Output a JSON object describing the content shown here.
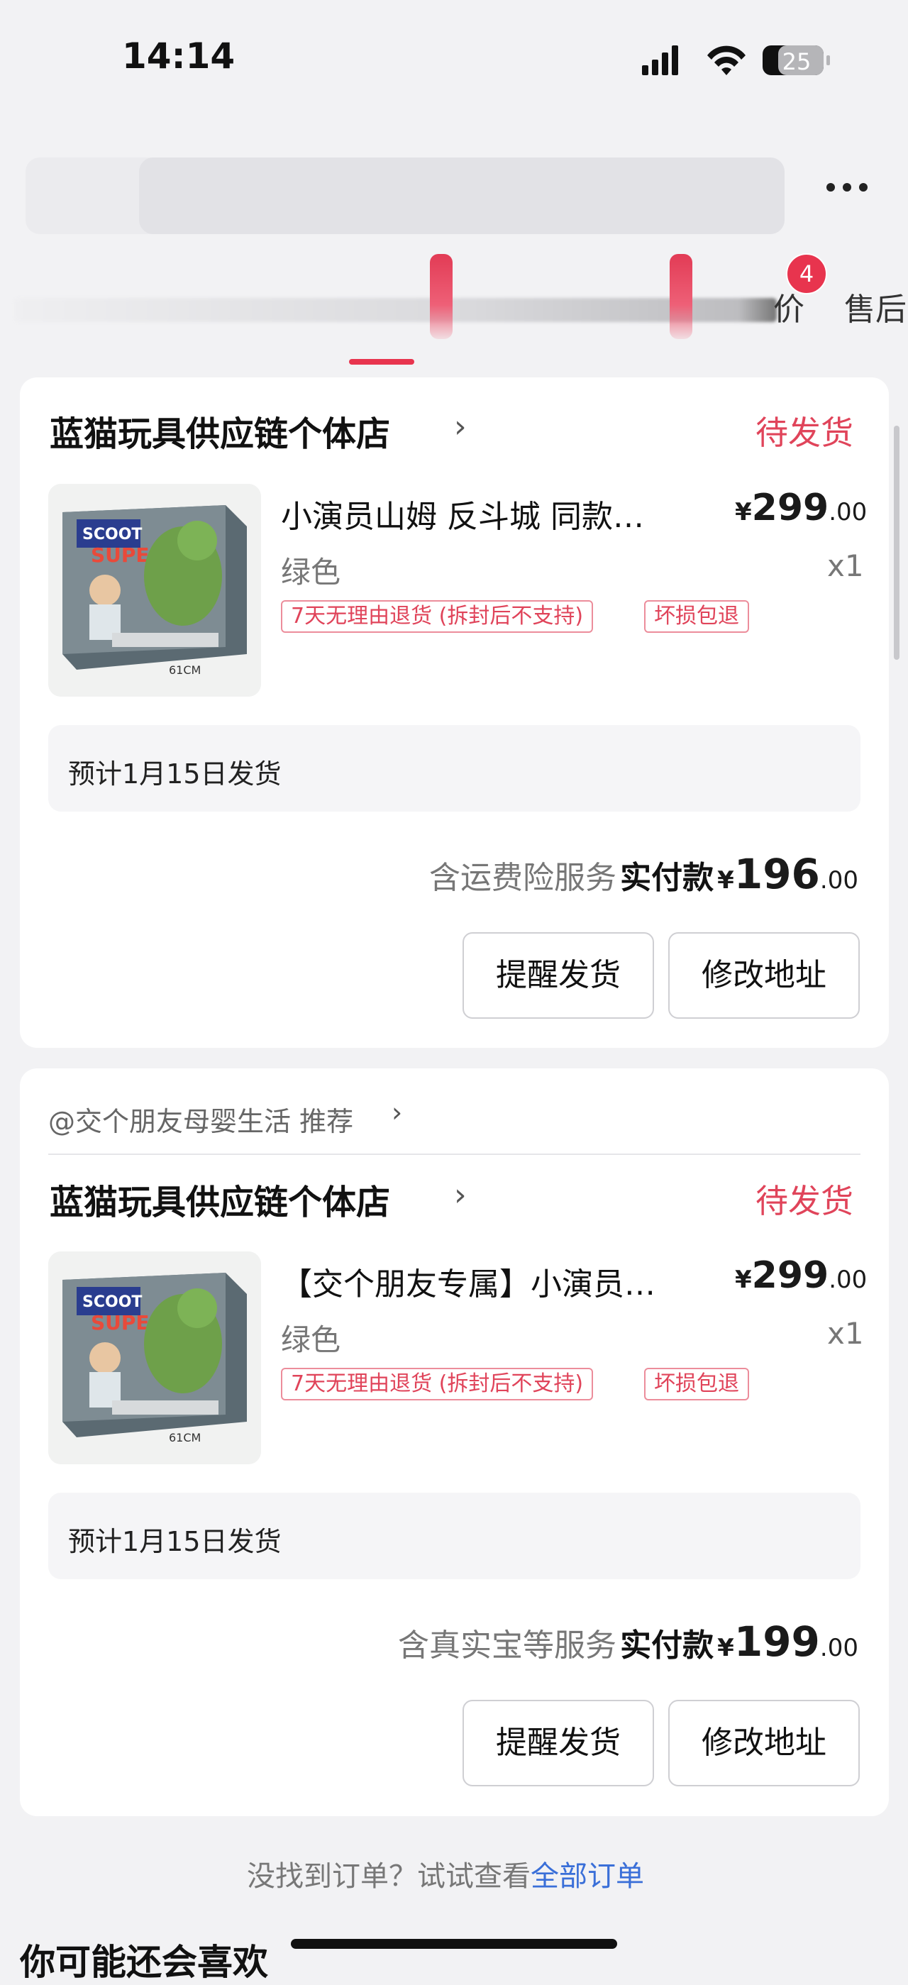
{
  "status_bar": {
    "time": "14:14",
    "battery": "25"
  },
  "tabs": {
    "partial_label": "价",
    "after_sales_label": "售后",
    "badge_count": "4"
  },
  "orders": [
    {
      "recommender": "",
      "store": "蓝猫玩具供应链个体店",
      "status": "待发货",
      "title": "小演员山姆 反斗城 同款…",
      "price_symbol": "¥",
      "price_int": "299",
      "price_dec": ".00",
      "spec": "绿色",
      "qty": "x1",
      "tags": [
        "7天无理由退货 (拆封后不支持)",
        "坏损包退"
      ],
      "shipping": "预计1月15日发货",
      "service": "含运费险服务",
      "pay_label": "实付款",
      "pay_symbol": "¥",
      "pay_int": "196",
      "pay_dec": ".00",
      "btn_remind": "提醒发货",
      "btn_address": "修改地址",
      "thumb_size_label": "61CM"
    },
    {
      "recommender": "@交个朋友母婴生活 推荐",
      "store": "蓝猫玩具供应链个体店",
      "status": "待发货",
      "title": "【交个朋友专属】小演员…",
      "price_symbol": "¥",
      "price_int": "299",
      "price_dec": ".00",
      "spec": "绿色",
      "qty": "x1",
      "tags": [
        "7天无理由退货 (拆封后不支持)",
        "坏损包退"
      ],
      "shipping": "预计1月15日发货",
      "service": "含真实宝等服务",
      "pay_label": "实付款",
      "pay_symbol": "¥",
      "pay_int": "199",
      "pay_dec": ".00",
      "btn_remind": "提醒发货",
      "btn_address": "修改地址",
      "thumb_size_label": "61CM"
    }
  ],
  "footer": {
    "hint": "没找到订单？试试查看",
    "link": "全部订单",
    "guess_title": "你可能还会喜欢"
  },
  "colors": {
    "accent": "#e8344e",
    "link": "#3a6fd8"
  }
}
